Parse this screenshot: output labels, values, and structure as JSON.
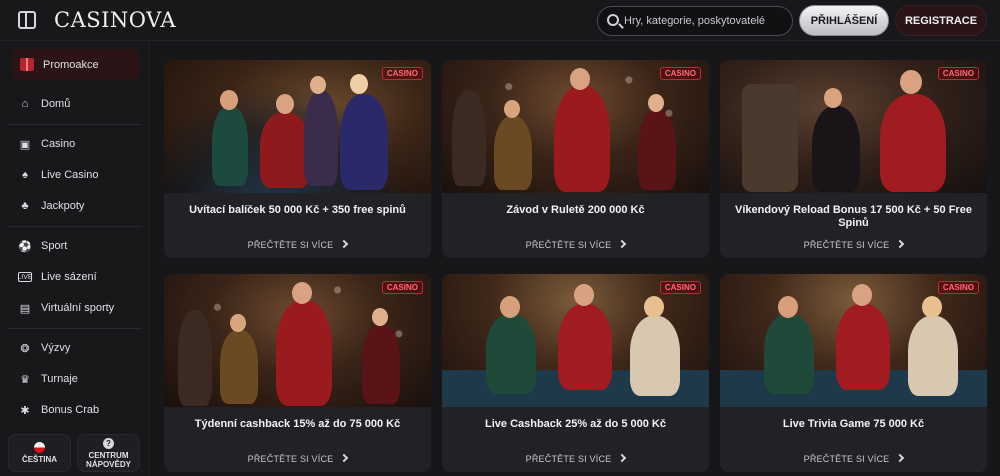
{
  "header": {
    "logo_text": "CASINOVA",
    "search_placeholder": "Hry, kategorie, poskytovatelé",
    "login_label": "PŘIHLÁŠENÍ",
    "register_label": "REGISTRACE"
  },
  "sidebar": {
    "promo_label": "Promoakce",
    "items": [
      {
        "label": "Domů",
        "icon": "home-icon"
      },
      {
        "label": "Casino",
        "icon": "slot-machine-icon"
      },
      {
        "label": "Live Casino",
        "icon": "cards-icon"
      },
      {
        "label": "Jackpoty",
        "icon": "clover-icon"
      },
      {
        "label": "Sport",
        "icon": "soccer-ball-icon"
      },
      {
        "label": "Live sázení",
        "icon": "live-icon"
      },
      {
        "label": "Virtuální sporty",
        "icon": "virtual-sports-icon"
      },
      {
        "label": "Výzvy",
        "icon": "challenge-icon"
      },
      {
        "label": "Turnaje",
        "icon": "trophy-icon"
      },
      {
        "label": "Bonus Crab",
        "icon": "crab-icon"
      }
    ],
    "language_label": "ČEŠTINA",
    "help_label_1": "CENTRUM",
    "help_label_2": "NÁPOVĚDY"
  },
  "promotions": [
    {
      "tag": "CASINO",
      "title": "Uvítací balíček 50 000 Kč + 350 free spinů",
      "link": "PŘEČTĚTE SI VÍCE"
    },
    {
      "tag": "CASINO",
      "title": "Závod v Ruletě 200 000 Kč",
      "link": "PŘEČTĚTE SI VÍCE"
    },
    {
      "tag": "CASINO",
      "title": "Víkendový Reload Bonus 17 500 Kč + 50 Free Spinů",
      "link": "PŘEČTĚTE SI VÍCE"
    },
    {
      "tag": "CASINO",
      "title": "Týdenní cashback 15% až do 75 000 Kč",
      "link": "PŘEČTĚTE SI VÍCE"
    },
    {
      "tag": "CASINO",
      "title": "Live Cashback 25% až do 5 000 Kč",
      "link": "PŘEČTĚTE SI VÍCE"
    },
    {
      "tag": "CASINO",
      "title": "Live Trivia Game 75 000 Kč",
      "link": "PŘEČTĚTE SI VÍCE"
    }
  ],
  "colors": {
    "accent_red": "#b3262e",
    "background": "#17171a",
    "card": "#222226"
  }
}
